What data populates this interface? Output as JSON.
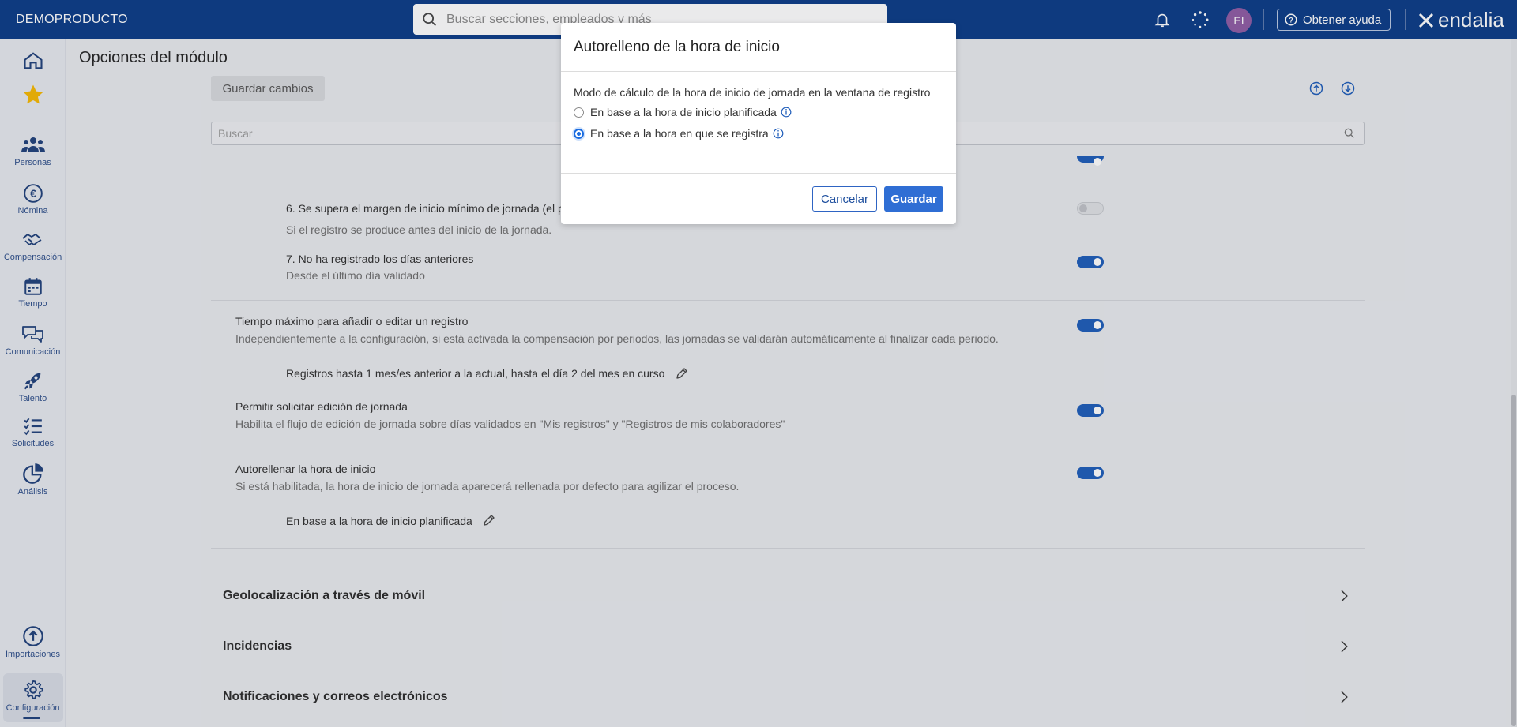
{
  "topbar": {
    "brand": "DEMOPRODUCTO",
    "search_placeholder": "Buscar secciones, empleados y más",
    "avatar_initials": "EI",
    "help_label": "Obtener ayuda",
    "logo_text": "endalia"
  },
  "sidebar": {
    "items": [
      {
        "label": "",
        "icon": "home-icon"
      },
      {
        "label": "",
        "icon": "star-icon"
      },
      {
        "label": "Personas",
        "icon": "people-icon"
      },
      {
        "label": "Nómina",
        "icon": "euro-icon"
      },
      {
        "label": "Compensación",
        "icon": "handshake-icon"
      },
      {
        "label": "Tiempo",
        "icon": "calendar-icon"
      },
      {
        "label": "Comunicación",
        "icon": "chat-icon"
      },
      {
        "label": "Talento",
        "icon": "rocket-icon"
      },
      {
        "label": "Solicitudes",
        "icon": "checklist-icon"
      },
      {
        "label": "Análisis",
        "icon": "pie-chart-icon"
      },
      {
        "label": "Importaciones",
        "icon": "upload-icon"
      },
      {
        "label": "Configuración",
        "icon": "gear-icon"
      }
    ]
  },
  "page": {
    "title": "Opciones del módulo",
    "save_changes": "Guardar cambios",
    "filter_placeholder": "Buscar"
  },
  "settings": {
    "rule6_title": "6. Se supera el margen de inicio mínimo de jornada (el p",
    "rule6_desc": "Si el registro se produce antes del inicio de la jornada.",
    "rule6_enabled": false,
    "rule7_title": "7. No ha registrado los días anteriores",
    "rule7_desc": "Desde el último día validado",
    "rule7_enabled": true,
    "maxtime_title": "Tiempo máximo para añadir o editar un registro",
    "maxtime_desc": "Independientemente a la configuración, si está activada la compensación por periodos, las jornadas se validarán automáticamente al finalizar cada periodo.",
    "maxtime_value": "Registros hasta 1 mes/es anterior a la actual, hasta el día 2 del mes en curso",
    "maxtime_enabled": true,
    "edit_title": "Permitir solicitar edición de jornada",
    "edit_desc": "Habilita el flujo de edición de jornada sobre días validados en \"Mis registros\" y \"Registros de mis colaboradores\"",
    "edit_enabled": true,
    "autofill_title": "Autorellenar la hora de inicio",
    "autofill_desc": "Si está habilitada, la hora de inicio de jornada aparecerá rellenada por defecto para agilizar el proceso.",
    "autofill_value": "En base a la hora de inicio planificada",
    "autofill_enabled": true
  },
  "sections": [
    {
      "label": "Geolocalización a través de móvil"
    },
    {
      "label": "Incidencias"
    },
    {
      "label": "Notificaciones y correos electrónicos"
    }
  ],
  "modal": {
    "title": "Autorelleno de la hora de inicio",
    "description": "Modo de cálculo de la hora de inicio de jornada en la ventana de registro",
    "options": [
      {
        "label": "En base a la hora de inicio planificada",
        "selected": false
      },
      {
        "label": "En base a la hora en que se registra",
        "selected": true
      }
    ],
    "cancel_label": "Cancelar",
    "save_label": "Guardar"
  },
  "colors": {
    "topbar": "#083a86",
    "accent": "#1c5bb9",
    "primary_button": "#2f6ed4",
    "avatar": "#8e5aa3"
  }
}
